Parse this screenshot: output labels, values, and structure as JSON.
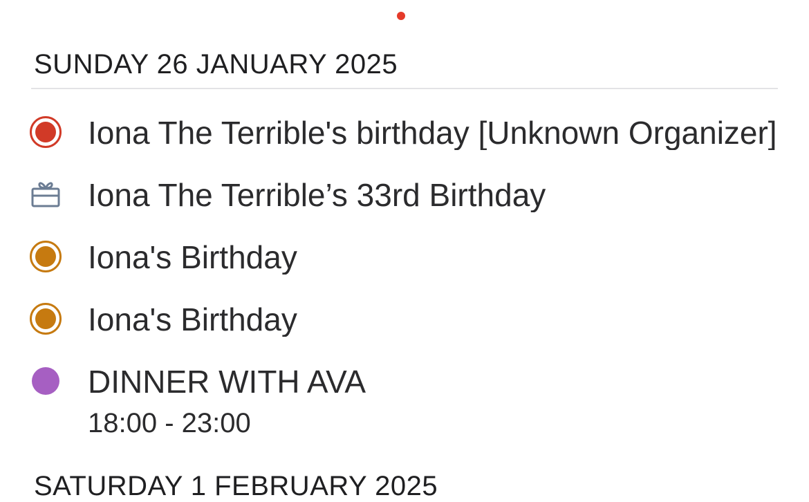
{
  "status": {
    "indicator_color": "#e53a2a"
  },
  "day_section": {
    "header": "SUNDAY 26 JANUARY 2025",
    "events": [
      {
        "title": "Iona The Terrible's birthday [Unknown Organizer]",
        "marker": "ring-dot-icon",
        "color": "#d13a27"
      },
      {
        "title": "Iona The Terrible’s 33rd Birthday",
        "marker": "birthday-gift-icon",
        "color": "#6b7c93"
      },
      {
        "title": "Iona's Birthday",
        "marker": "ring-dot-icon",
        "color": "#c67a10"
      },
      {
        "title": "Iona's Birthday",
        "marker": "ring-dot-icon",
        "color": "#c67a10"
      },
      {
        "title": "DINNER WITH AVA",
        "time": "18:00 - 23:00",
        "marker": "solid-dot-icon",
        "color": "#a65fc2"
      }
    ]
  },
  "next_section": {
    "header": "SATURDAY 1 FEBRUARY 2025"
  }
}
